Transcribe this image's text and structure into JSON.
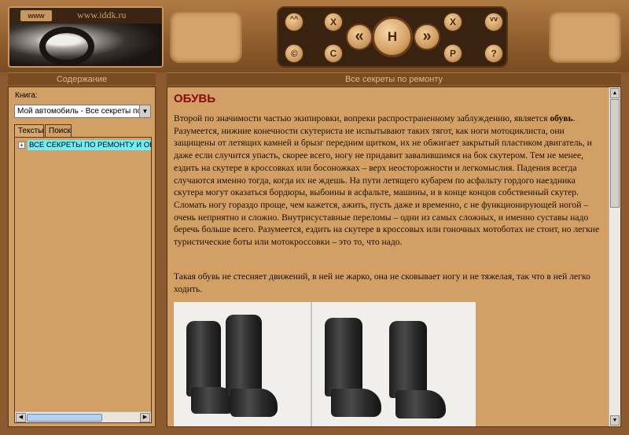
{
  "header": {
    "logo_www": "www",
    "logo_url": "www.iddk.ru",
    "nav": {
      "up_label": "^^",
      "copyright_label": "©",
      "close_left_label": "X",
      "contents_label": "C",
      "back_label": "«",
      "home_label": "H",
      "forward_label": "»",
      "close_right_label": "X",
      "print_label": "P",
      "down_label": "vv",
      "help_label": "?"
    }
  },
  "titlebars": {
    "left": "Содержание",
    "right": "Все секреты по ремонту"
  },
  "sidebar": {
    "book_label": "Книга:",
    "book_select_value": "Мой автомобиль - Все секреты по ре",
    "tabs": [
      {
        "label": "Тексты"
      },
      {
        "label": "Поиск"
      }
    ],
    "tree": [
      {
        "label": "ВСЕ СЕКРЕТЫ ПО РЕМОНТУ И ОБСЛ",
        "expander": "+"
      }
    ]
  },
  "article": {
    "title": "ОБУВЬ",
    "p1_before": "Второй по значимости частью экипировки, вопреки распространенному заблуждению, является ",
    "p1_bold": "обувь",
    "p1_after": ". Разумеется, нижние конечности скутериста не испытывают таких тягот, как ноги мотоциклиста, они защищены от летящих камней и брызг передним щитком, их не обжигает закрытый пластиком двигатель, и даже если случится упасть, скорее всего, ногу не придавит завалившимся на бок скутером. Тем не менее, ездить на скутере в кроссовках или босоножках – верх неосторожности и легкомыслия. Падения всегда случаются именно тогда, когда их не ждешь. На пути летящего кубарем по асфальту гордого наездника скутера могут оказаться бордюры, выбоины в асфальте, машины, и в конце концов собственный скутер. Сломать ногу гораздо проще, чем кажется, ажить, пусть даже и временно, с не функционирующей ногой – очень неприятно и сложно. Внутрисуставные переломы – одни из самых сложных, и именно суставы надо беречь больше всего. Разумеется, ездить на скутере в кроссовых или гоночных мотоботах не стоит, но легкие туристические боты или мотокроссовки – это то, что надо.",
    "p2": "Такая обувь не стесняет движений, в ней не жарко, она не сковывает ногу и не тяжелая, так что в ней легко ходить."
  },
  "colors": {
    "accent_title": "#8a0a0a",
    "panel_bg": "#d2a065",
    "frame_bg": "#8a5a2e",
    "tree_highlight": "#6ef0f8"
  }
}
